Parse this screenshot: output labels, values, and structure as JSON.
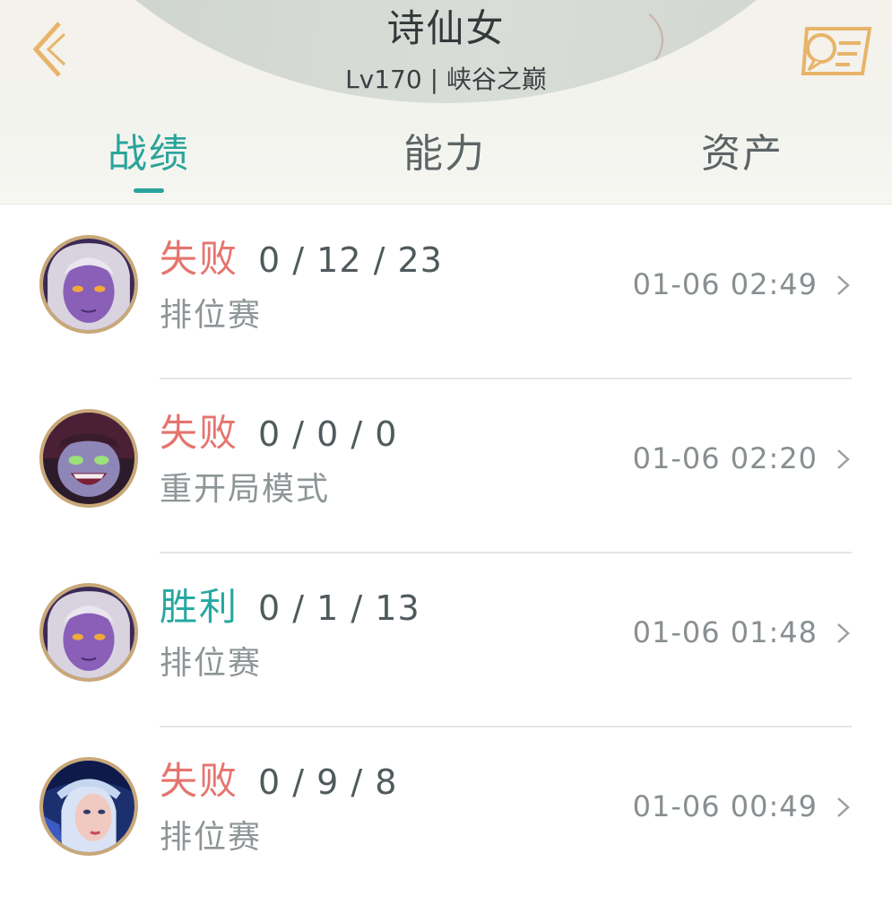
{
  "header": {
    "title": "诗仙女",
    "subtitle": "Lv170 | 峡谷之巅",
    "back_icon": "back-chevron-icon",
    "message_icon": "message-card-icon",
    "accent": "#2aa49a",
    "icon_color": "#e8b46a"
  },
  "tabs": [
    {
      "label": "战绩",
      "active": true
    },
    {
      "label": "能力",
      "active": false
    },
    {
      "label": "资产",
      "active": false
    }
  ],
  "matches": [
    {
      "result": "失败",
      "outcome": "lose",
      "kda": "0 / 12 / 23",
      "mode": "排位赛",
      "time": "01-06 02:49",
      "avatar": "purple-champion-avatar"
    },
    {
      "result": "失败",
      "outcome": "lose",
      "kda": "0 / 0 / 0",
      "mode": "重开局模式",
      "time": "01-06 02:20",
      "avatar": "grinning-champion-avatar"
    },
    {
      "result": "胜利",
      "outcome": "win",
      "kda": "0 / 1 / 13",
      "mode": "排位赛",
      "time": "01-06 01:48",
      "avatar": "purple-champion-avatar"
    },
    {
      "result": "失败",
      "outcome": "lose",
      "kda": "0 / 9 / 8",
      "mode": "排位赛",
      "time": "01-06 00:49",
      "avatar": "archer-champion-avatar"
    }
  ],
  "colors": {
    "lose": "#e5746e",
    "win": "#27a8a2"
  }
}
